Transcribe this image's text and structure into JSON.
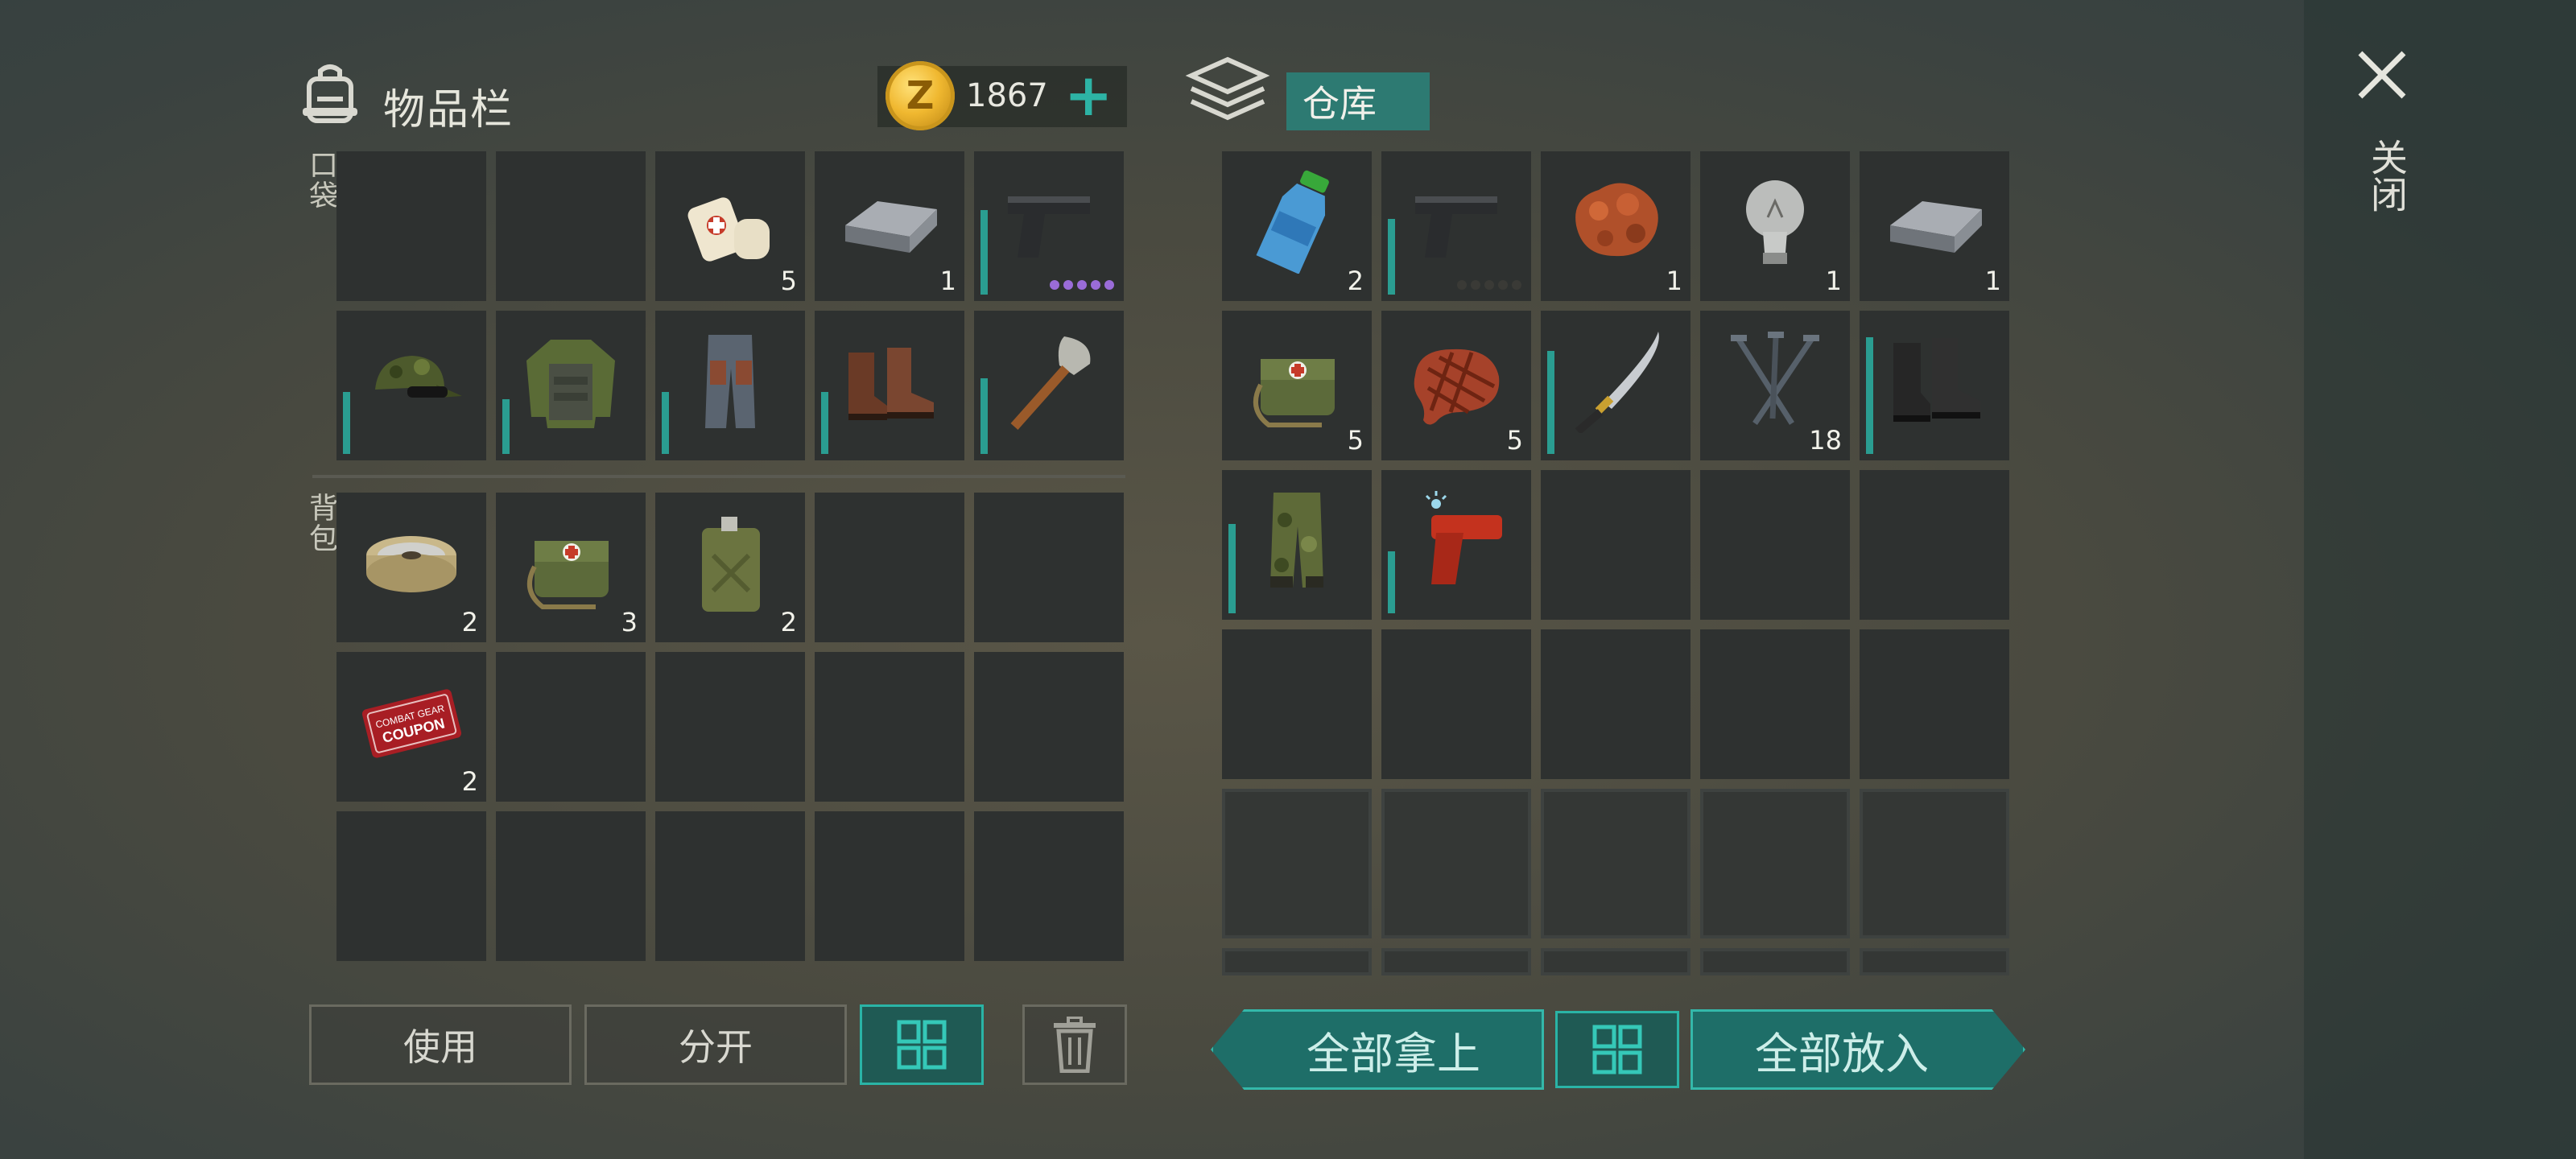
{
  "inventory": {
    "title": "物品栏",
    "coins": "1867",
    "pocket_label": "口袋",
    "backpack_label": "背包",
    "pocket_slots": [
      {
        "item": "empty"
      },
      {
        "item": "empty"
      },
      {
        "item": "bandage-icon",
        "count": "5"
      },
      {
        "item": "metal-ingot-icon",
        "count": "1"
      },
      {
        "item": "pistol-icon",
        "bar": 0.62,
        "dots_color": "#9a6cd8"
      },
      {
        "item": "camo-cap-icon",
        "bar": 0.45
      },
      {
        "item": "camo-jacket-icon",
        "bar": 0.4
      },
      {
        "item": "pants-icon",
        "bar": 0.45
      },
      {
        "item": "boots-icon",
        "bar": 0.45
      },
      {
        "item": "shovel-icon",
        "bar": 0.55
      }
    ],
    "backpack_slots": [
      {
        "item": "wire-spool-icon",
        "count": "2"
      },
      {
        "item": "medkit-bag-icon",
        "count": "3"
      },
      {
        "item": "jerrycan-icon",
        "count": "2"
      },
      {
        "item": "empty"
      },
      {
        "item": "empty"
      },
      {
        "item": "combat-gear-coupon-icon",
        "count": "2"
      },
      {
        "item": "empty"
      },
      {
        "item": "empty"
      },
      {
        "item": "empty"
      },
      {
        "item": "empty"
      },
      {
        "item": "empty"
      },
      {
        "item": "empty"
      },
      {
        "item": "empty"
      },
      {
        "item": "empty"
      },
      {
        "item": "empty"
      }
    ],
    "buttons": {
      "use": "使用",
      "split": "分开"
    }
  },
  "storage": {
    "title": "仓库",
    "slots": [
      {
        "item": "water-bottle-icon",
        "count": "2"
      },
      {
        "item": "pistol-icon",
        "bar": 0.55,
        "dots_color": "#3a3a36"
      },
      {
        "item": "copper-ore-icon",
        "count": "1"
      },
      {
        "item": "light-bulb-icon",
        "count": "1"
      },
      {
        "item": "metal-ingot-icon",
        "count": "1"
      },
      {
        "item": "medkit-bag-icon",
        "count": "5"
      },
      {
        "item": "steak-icon",
        "count": "5"
      },
      {
        "item": "katana-icon",
        "bar": 0.75
      },
      {
        "item": "nails-icon",
        "count": "18"
      },
      {
        "item": "black-boots-icon",
        "bar": 0.85
      },
      {
        "item": "camo-pants-icon",
        "bar": 0.65
      },
      {
        "item": "flare-gun-icon",
        "bar": 0.45
      }
    ],
    "buttons": {
      "take_all": "全部拿上",
      "put_all": "全部放入"
    }
  },
  "close_label": "关闭",
  "colors": {
    "accent": "#2ab4a6",
    "bar": "#2a9d91",
    "slot": "#2e3130"
  },
  "coin_letter": "Z",
  "coupon_text": "COMBAT GEAR COUPON"
}
